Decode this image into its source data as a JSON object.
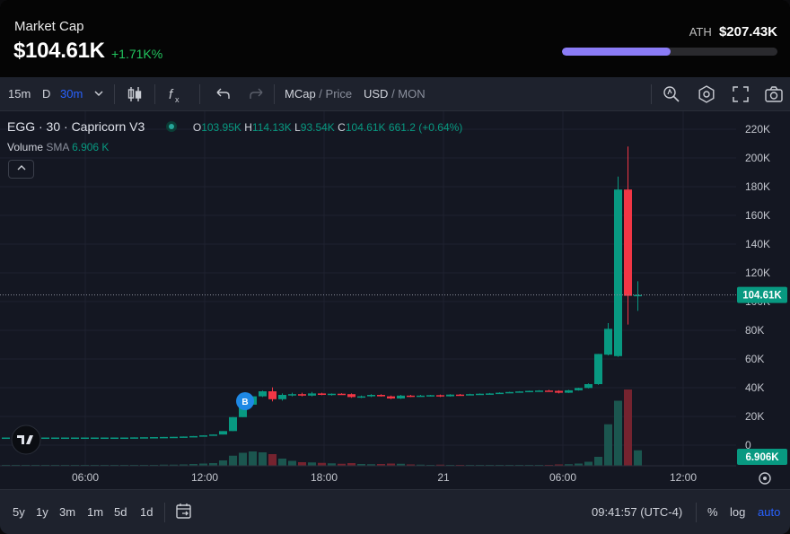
{
  "header": {
    "label": "Market Cap",
    "value": "$104.61K",
    "change": "+1.71K%",
    "ath_label": "ATH",
    "ath_value": "$207.43K",
    "ath_progress": 0.504
  },
  "toolbar": {
    "intervals": [
      "15m",
      "D",
      "30m"
    ],
    "active_interval": "30m",
    "mcap_label": "MCap",
    "price_label": "Price",
    "usd_label": "USD",
    "mon_label": "MON"
  },
  "legend": {
    "symbol": "EGG · 30 · Capricorn V3",
    "o_label": "O",
    "o": "103.95K",
    "h_label": "H",
    "h": "114.13K",
    "l_label": "L",
    "l": "93.54K",
    "c_label": "C",
    "c": "104.61K",
    "change": "661.2 (+0.64%)",
    "volume_label": "Volume",
    "sma_label": "SMA",
    "volume_value": "6.906 K"
  },
  "price_badge": "104.61K",
  "volume_badge": "6.906K",
  "trade_marker": "B",
  "bottom": {
    "ranges": [
      "5y",
      "1y",
      "3m",
      "1m",
      "5d",
      "1d"
    ],
    "time": "09:41:57 (UTC-4)",
    "percent": "%",
    "log": "log",
    "auto": "auto"
  },
  "chart_data": {
    "type": "candlestick",
    "y_ticks": [
      "220K",
      "200K",
      "180K",
      "160K",
      "140K",
      "120K",
      "100K",
      "80K",
      "60K",
      "40K",
      "20K",
      "0"
    ],
    "ylim": [
      0,
      220
    ],
    "x_ticks": [
      "06:00",
      "12:00",
      "18:00",
      "21",
      "06:00",
      "12:00"
    ],
    "colors": {
      "up": "#089981",
      "down": "#f23645",
      "bg": "#141722"
    },
    "candles": [
      {
        "o": 5.3,
        "h": 5.3,
        "l": 5.3,
        "c": 5.3,
        "v": 0.3
      },
      {
        "o": 5.3,
        "h": 5.3,
        "l": 5.3,
        "c": 5.3,
        "v": 0.3
      },
      {
        "o": 5.3,
        "h": 5.3,
        "l": 5.3,
        "c": 5.3,
        "v": 0.3
      },
      {
        "o": 5.3,
        "h": 5.3,
        "l": 5.3,
        "c": 5.3,
        "v": 0.3
      },
      {
        "o": 5.3,
        "h": 5.3,
        "l": 5.3,
        "c": 5.3,
        "v": 0.3
      },
      {
        "o": 5.3,
        "h": 5.3,
        "l": 5.3,
        "c": 5.3,
        "v": 0.3
      },
      {
        "o": 5.3,
        "h": 5.3,
        "l": 5.3,
        "c": 5.3,
        "v": 0.3
      },
      {
        "o": 5.3,
        "h": 5.3,
        "l": 5.3,
        "c": 5.3,
        "v": 0.3
      },
      {
        "o": 5.3,
        "h": 5.3,
        "l": 5.3,
        "c": 5.3,
        "v": 0.3
      },
      {
        "o": 5.3,
        "h": 5.3,
        "l": 5.3,
        "c": 5.3,
        "v": 0.3
      },
      {
        "o": 5.3,
        "h": 5.3,
        "l": 5.3,
        "c": 5.3,
        "v": 0.3
      },
      {
        "o": 5.3,
        "h": 5.3,
        "l": 5.3,
        "c": 5.3,
        "v": 0.3
      },
      {
        "o": 5.3,
        "h": 5.3,
        "l": 5.3,
        "c": 5.3,
        "v": 0.3
      },
      {
        "o": 5.3,
        "h": 5.4,
        "l": 5.3,
        "c": 5.4,
        "v": 0.4
      },
      {
        "o": 5.4,
        "h": 5.5,
        "l": 5.4,
        "c": 5.5,
        "v": 0.4
      },
      {
        "o": 5.5,
        "h": 5.6,
        "l": 5.5,
        "c": 5.6,
        "v": 0.4
      },
      {
        "o": 5.6,
        "h": 5.7,
        "l": 5.6,
        "c": 5.7,
        "v": 0.5
      },
      {
        "o": 5.7,
        "h": 5.8,
        "l": 5.7,
        "c": 5.8,
        "v": 0.5
      },
      {
        "o": 5.8,
        "h": 6.0,
        "l": 5.8,
        "c": 6.0,
        "v": 0.6
      },
      {
        "o": 6.0,
        "h": 6.3,
        "l": 6.0,
        "c": 6.3,
        "v": 0.8
      },
      {
        "o": 6.3,
        "h": 6.8,
        "l": 6.3,
        "c": 6.8,
        "v": 1.0
      },
      {
        "o": 6.8,
        "h": 7.4,
        "l": 6.8,
        "c": 7.4,
        "v": 1.2
      },
      {
        "o": 7.4,
        "h": 9.8,
        "l": 7.4,
        "c": 9.8,
        "v": 2.4
      },
      {
        "o": 9.8,
        "h": 19.5,
        "l": 9.8,
        "c": 19.5,
        "v": 4.5
      },
      {
        "o": 19.5,
        "h": 28.2,
        "l": 19.5,
        "c": 28.2,
        "v": 5.8
      },
      {
        "o": 28.2,
        "h": 34.0,
        "l": 28.0,
        "c": 34.0,
        "v": 6.4
      },
      {
        "o": 34.0,
        "h": 38.0,
        "l": 33.5,
        "c": 37.5,
        "v": 6.0
      },
      {
        "o": 37.5,
        "h": 40.2,
        "l": 30.5,
        "c": 32.0,
        "v": 5.2
      },
      {
        "o": 32.0,
        "h": 36.0,
        "l": 31.0,
        "c": 35.0,
        "v": 3.2
      },
      {
        "o": 35.0,
        "h": 36.5,
        "l": 34.0,
        "c": 35.5,
        "v": 2.2
      },
      {
        "o": 35.5,
        "h": 36.5,
        "l": 34.0,
        "c": 34.5,
        "v": 1.6
      },
      {
        "o": 34.5,
        "h": 37.0,
        "l": 34.0,
        "c": 36.0,
        "v": 1.5
      },
      {
        "o": 36.0,
        "h": 36.5,
        "l": 34.8,
        "c": 35.0,
        "v": 1.3
      },
      {
        "o": 35.0,
        "h": 36.0,
        "l": 34.5,
        "c": 35.8,
        "v": 1.1
      },
      {
        "o": 35.8,
        "h": 36.2,
        "l": 35.0,
        "c": 35.5,
        "v": 0.9
      },
      {
        "o": 35.5,
        "h": 36.0,
        "l": 33.0,
        "c": 33.5,
        "v": 1.2
      },
      {
        "o": 33.5,
        "h": 34.5,
        "l": 32.8,
        "c": 34.0,
        "v": 0.8
      },
      {
        "o": 34.0,
        "h": 35.5,
        "l": 33.5,
        "c": 35.0,
        "v": 0.7
      },
      {
        "o": 35.0,
        "h": 35.5,
        "l": 33.8,
        "c": 34.0,
        "v": 0.8
      },
      {
        "o": 34.0,
        "h": 34.5,
        "l": 32.0,
        "c": 32.5,
        "v": 1.0
      },
      {
        "o": 32.5,
        "h": 35.0,
        "l": 32.2,
        "c": 34.5,
        "v": 0.9
      },
      {
        "o": 34.5,
        "h": 35.0,
        "l": 33.5,
        "c": 34.0,
        "v": 0.6
      },
      {
        "o": 34.0,
        "h": 35.0,
        "l": 33.8,
        "c": 34.5,
        "v": 0.5
      },
      {
        "o": 34.5,
        "h": 35.0,
        "l": 34.0,
        "c": 34.8,
        "v": 0.4
      },
      {
        "o": 34.8,
        "h": 35.2,
        "l": 33.5,
        "c": 34.0,
        "v": 0.5
      },
      {
        "o": 34.0,
        "h": 35.5,
        "l": 33.8,
        "c": 35.2,
        "v": 0.4
      },
      {
        "o": 35.2,
        "h": 35.6,
        "l": 34.5,
        "c": 35.0,
        "v": 0.3
      },
      {
        "o": 35.0,
        "h": 35.8,
        "l": 34.8,
        "c": 35.5,
        "v": 0.3
      },
      {
        "o": 35.5,
        "h": 36.0,
        "l": 35.0,
        "c": 35.8,
        "v": 0.3
      },
      {
        "o": 35.8,
        "h": 36.3,
        "l": 35.5,
        "c": 36.0,
        "v": 0.3
      },
      {
        "o": 36.0,
        "h": 36.8,
        "l": 35.8,
        "c": 36.5,
        "v": 0.4
      },
      {
        "o": 36.5,
        "h": 37.2,
        "l": 36.3,
        "c": 37.0,
        "v": 0.4
      },
      {
        "o": 37.0,
        "h": 37.6,
        "l": 36.8,
        "c": 37.4,
        "v": 0.4
      },
      {
        "o": 37.4,
        "h": 38.0,
        "l": 37.0,
        "c": 37.8,
        "v": 0.4
      },
      {
        "o": 37.8,
        "h": 38.3,
        "l": 37.5,
        "c": 38.0,
        "v": 0.4
      },
      {
        "o": 38.0,
        "h": 38.5,
        "l": 37.6,
        "c": 37.8,
        "v": 0.4
      },
      {
        "o": 37.8,
        "h": 38.2,
        "l": 36.0,
        "c": 36.5,
        "v": 0.6
      },
      {
        "o": 36.5,
        "h": 38.5,
        "l": 36.3,
        "c": 38.2,
        "v": 0.7
      },
      {
        "o": 38.2,
        "h": 40.0,
        "l": 38.0,
        "c": 39.8,
        "v": 1.0
      },
      {
        "o": 39.8,
        "h": 43.0,
        "l": 39.5,
        "c": 42.5,
        "v": 1.8
      },
      {
        "o": 42.5,
        "h": 63.5,
        "l": 42.0,
        "c": 63.5,
        "v": 4.0
      },
      {
        "o": 63.0,
        "h": 85.0,
        "l": 62.5,
        "c": 81.0,
        "v": 18.5
      },
      {
        "o": 62.0,
        "h": 187.0,
        "l": 61.5,
        "c": 178.0,
        "v": 29.0
      },
      {
        "o": 178.0,
        "h": 208.0,
        "l": 84.0,
        "c": 104.0,
        "v": 34.0
      },
      {
        "o": 104.0,
        "h": 114.13,
        "l": 93.54,
        "c": 104.61,
        "v": 6.906
      }
    ],
    "volume_max": 36
  }
}
